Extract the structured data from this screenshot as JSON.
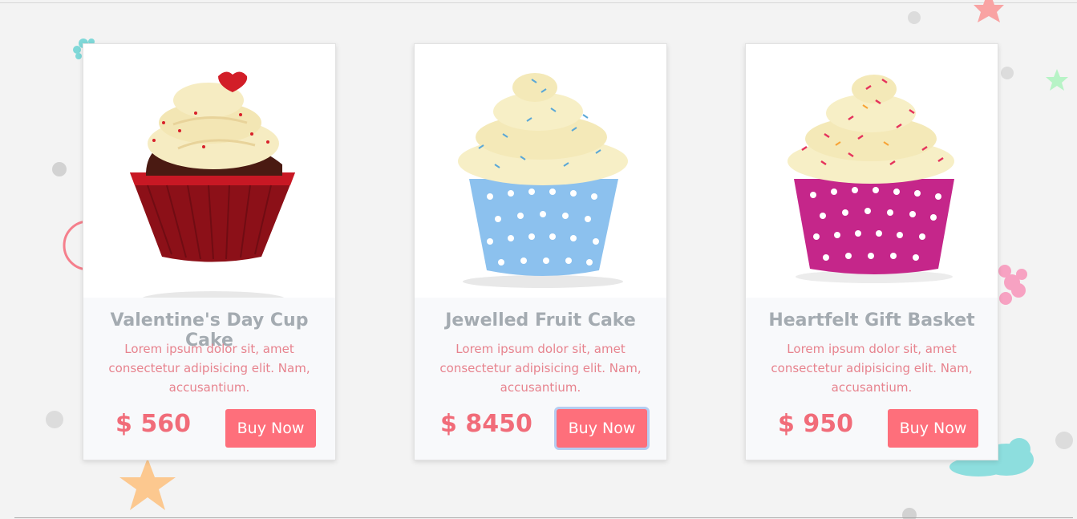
{
  "colors": {
    "background": "#f3f3f3",
    "title": "#a4abb1",
    "description": "#e7838e",
    "price": "#f16c79",
    "button": "#fe6f7b",
    "focus_ring": "#b6cdf1"
  },
  "products": [
    {
      "title": "Valentine's Day Cup Cake",
      "description": "Lorem ipsum dolor sit, amet consectetur adipisicing elit. Nam, accusantium.",
      "price": "$ 560",
      "button_label": "Buy Now",
      "image": "red-velvet-cupcake-image"
    },
    {
      "title": "Jewelled Fruit Cake",
      "description": "Lorem ipsum dolor sit, amet consectetur adipisicing elit. Nam, accusantium.",
      "price": "$ 8450",
      "button_label": "Buy Now",
      "image": "blue-polka-dot-cupcake-image",
      "button_focused": true
    },
    {
      "title": "Heartfelt Gift Basket",
      "description": "Lorem ipsum dolor sit, amet consectetur adipisicing elit. Nam, accusantium.",
      "price": "$ 950",
      "button_label": "Buy Now",
      "image": "pink-polka-dot-cupcake-image"
    }
  ]
}
